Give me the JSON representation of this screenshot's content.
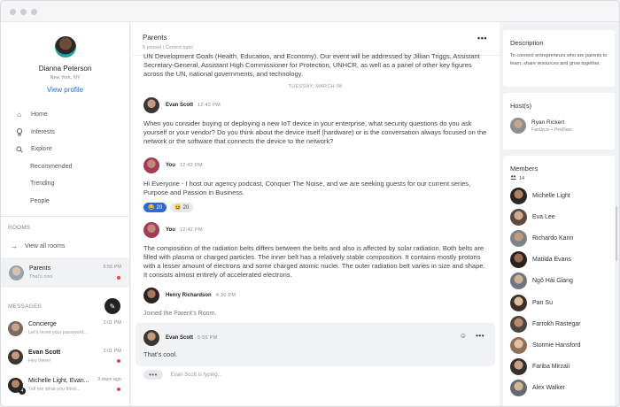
{
  "colors": {
    "accent": "#2a6bd6",
    "unread": "#e2483d",
    "edit_button": "#222222"
  },
  "profile": {
    "name": "Dianna Peterson",
    "location": "New York, NY",
    "link": "View profile"
  },
  "nav": [
    {
      "label": "Home",
      "icon": "home-icon"
    },
    {
      "label": "Interests",
      "icon": "bulb-icon"
    },
    {
      "label": "Explore",
      "icon": "search-icon"
    },
    {
      "label": "Recommended"
    },
    {
      "label": "Trending"
    },
    {
      "label": "People"
    }
  ],
  "rooms": {
    "section": "ROOMS",
    "view_all": "View all rooms",
    "active": {
      "name": "Parents",
      "preview": "That's cool",
      "time": "5:55 PM"
    }
  },
  "messages": {
    "section": "MESSAGES",
    "items": [
      {
        "name": "Concierge",
        "preview": "Let's reset your password...",
        "time": "2:01 PM",
        "unread": false
      },
      {
        "name": "Evan Scott",
        "preview": "Hey there!",
        "time": "2:01 PM",
        "unread": true
      },
      {
        "name": "Michelle Light, Evan...",
        "preview": "Tell me what you think...",
        "time": "3 days ago",
        "unread": true,
        "badge": "4"
      }
    ]
  },
  "chat": {
    "title": "Parents",
    "meta": "5 pinned  |  Current topic",
    "intro": "UN Development Goals (Health, Education, and Economy). Our event will be addressed by Jillian Triggs, Assistant Secretary-General, Assistant High Commissioner for Protection, UNHCR, as well as a panel of other key figures across the UN, national governments, and technology.",
    "date": "TUESDAY, MARCH 08",
    "posts": [
      {
        "author": "Evan Scott",
        "time": "12:42 PM",
        "text": "When you consider buying or deploying a new IoT device in your enterprise, what security questions do you ask yourself or your vendor? Do you think about the device itself (hardware) or is the conversation always focused on the network or the software that connects the device to the network?"
      },
      {
        "author": "You",
        "time": "12:42 PM",
        "text": "Hi Everyone - I host our agency podcast, Conquer The Noise, and we are seeking guests for our current series, Purpose and Passion in Business."
      },
      {
        "author": "You",
        "time": "12:42 PM",
        "text": "The composition of the radiation belts differs between the belts and also is affected by solar radiation. Both belts are filled with plasma or charged particles. The inner belt has a relatively stable composition. It contains mostly protons with a lesser amount of electrons and some charged atomic nuclei. The outer radiation belt varies in size and shape. It consists almost entirely of accelerated electrons."
      },
      {
        "author": "Henry Richardson",
        "time": "4:30 PM",
        "text": "Joined the Parent's Room."
      },
      {
        "author": "Evan Scott",
        "time": "5:55 PM",
        "text": "That's cool."
      }
    ],
    "reactions": [
      {
        "emoji": "😂",
        "count": "20"
      },
      {
        "emoji": "😆",
        "count": "20"
      }
    ],
    "typing": "Evan Scott is typing..."
  },
  "description": {
    "title": "Description",
    "text": "To connect entrepreneurs who are parents to learn, share resources and grow together."
  },
  "hosts": {
    "title": "Host(s)",
    "name": "Ryan Rickert",
    "sub": "FanUp.io + PintPass"
  },
  "members": {
    "title": "Members",
    "count": "14",
    "list": [
      "Michelle Light",
      "Eva Lee",
      "Richardo Kann",
      "Matilda Evans",
      "Ngô Hải Giang",
      "Pan Su",
      "Farrokh Rastegar",
      "Stormie Hansford",
      "Fariba Mirzaii",
      "Alex Walker"
    ]
  }
}
